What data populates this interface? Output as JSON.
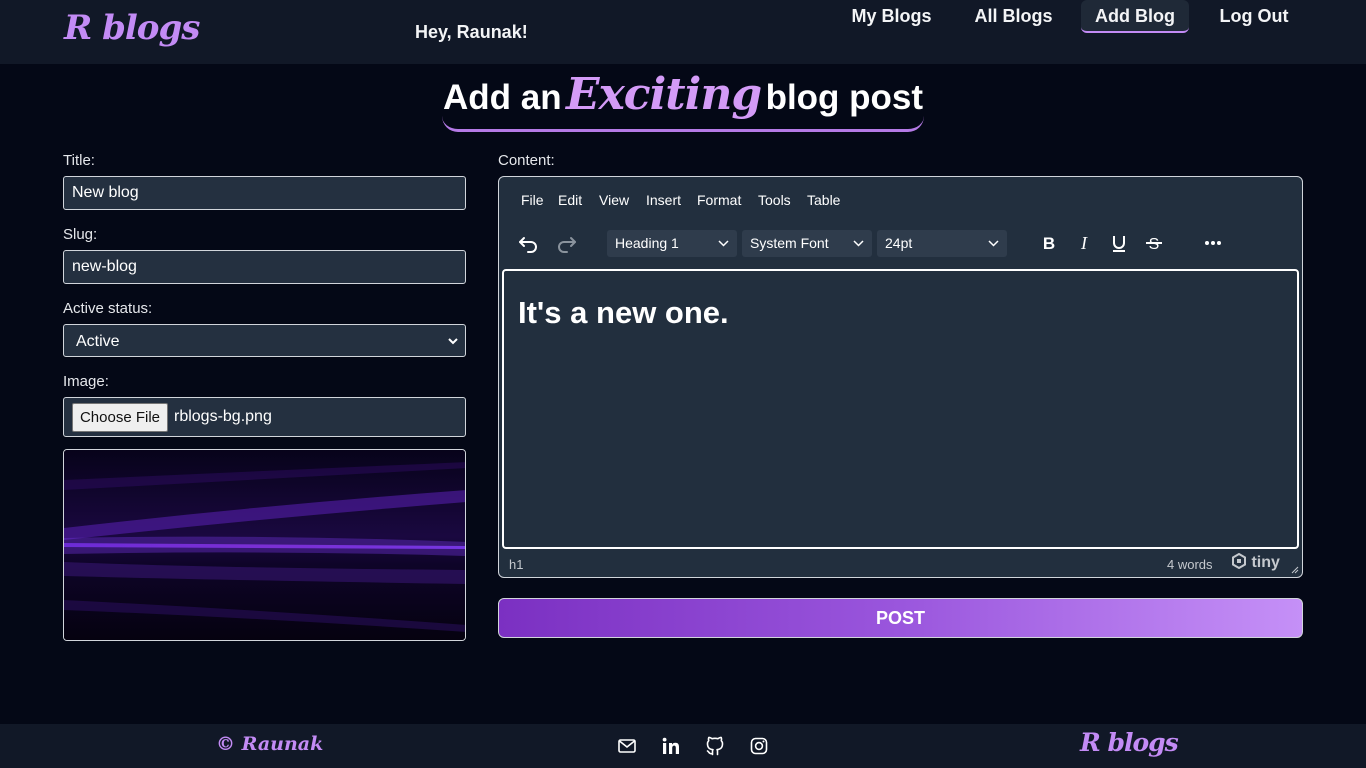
{
  "header": {
    "logo": "R blogs",
    "greeting": "Hey, Raunak!",
    "nav": [
      {
        "label": "My Blogs"
      },
      {
        "label": "All Blogs"
      },
      {
        "label": "Add Blog",
        "active": true
      },
      {
        "label": "Log Out"
      }
    ]
  },
  "page": {
    "title_before": "Add an",
    "title_accent": "Exciting",
    "title_after": "blog post"
  },
  "form": {
    "title_label": "Title:",
    "title_value": "New blog",
    "slug_label": "Slug:",
    "slug_value": "new-blog",
    "status_label": "Active status:",
    "status_value": "Active",
    "image_label": "Image:",
    "choose_file_label": "Choose File",
    "file_name": "rblogs-bg.png",
    "content_label": "Content:"
  },
  "editor": {
    "menu": [
      "File",
      "Edit",
      "View",
      "Insert",
      "Format",
      "Tools",
      "Table"
    ],
    "block_format": "Heading 1",
    "font_family": "System Font",
    "font_size": "24pt",
    "toolbar_icons": [
      "undo-icon",
      "redo-icon",
      "bold-icon",
      "italic-icon",
      "underline-icon",
      "strikethrough-icon",
      "more-icon"
    ],
    "content_text": "It's a new one.",
    "status_path": "h1",
    "word_count": "4 words",
    "brand": "tiny"
  },
  "post_button": "POST",
  "footer": {
    "copyright_symbol": "©",
    "copyright_name": "Raunak",
    "logo": "R blogs",
    "icons": [
      "mail-icon",
      "linkedin-icon",
      "github-icon",
      "instagram-icon"
    ]
  },
  "colors": {
    "background": "#040816",
    "header_bg": "#111827",
    "accent": "#c38bf5",
    "editor_bg": "#222f3e",
    "input_bg": "#243040"
  }
}
